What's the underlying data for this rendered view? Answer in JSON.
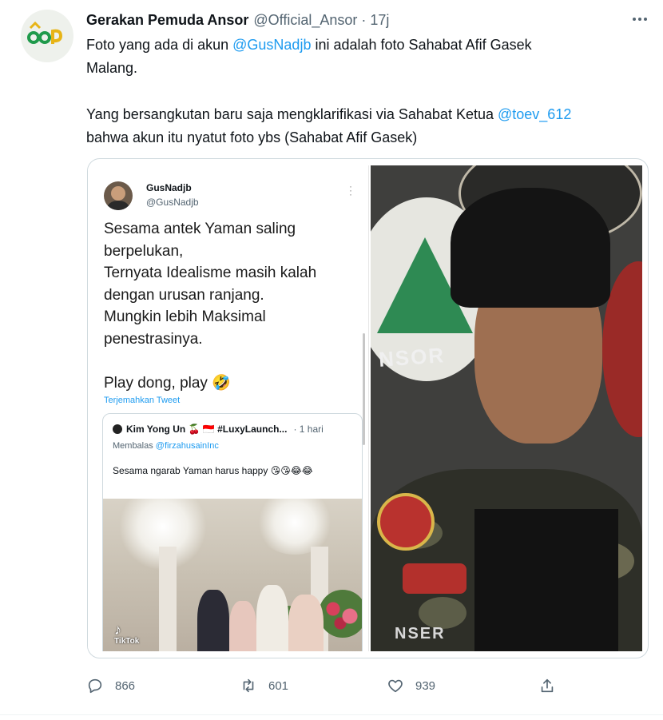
{
  "tweet": {
    "author_name": "Gerakan Pemuda Ansor",
    "author_handle": "@Official_Ansor",
    "separator": "·",
    "time": "17j",
    "text": {
      "line1_a": "Foto yang ada di akun ",
      "line1_link": "@GusNadjb",
      "line1_b": " ini adalah foto Sahabat Afif Gasek",
      "line2": "Malang.",
      "line3_a": "Yang bersangkutan baru saja mengklarifikasi via Sahabat Ketua ",
      "line3_link": "@toev_612",
      "line4": "bahwa akun itu nyatut foto ybs (Sahabat Afif Gasek)"
    },
    "actions": {
      "reply_count": "866",
      "retweet_count": "601",
      "like_count": "939"
    },
    "icons": {
      "more": "more-horizontal-icon",
      "reply": "reply-bubble-icon",
      "retweet": "retweet-icon",
      "like": "heart-icon",
      "share": "share-icon"
    }
  },
  "embedded_screenshot": {
    "name": "GusNadjb",
    "handle": "@GusNadjb",
    "lines": [
      "Sesama antek Yaman saling",
      "berpelukan,",
      "Ternyata Idealisme masih kalah",
      "dengan urusan ranjang.",
      "Mungkin lebih Maksimal",
      "penestrasinya."
    ],
    "play_line": "Play dong, play 🤣",
    "translate": "Terjemahkan Tweet",
    "quote": {
      "name": "Kim Yong Un 🍒 🇮🇩 #LuxyLaunch...",
      "time": "· 1 hari",
      "reply_prefix": "Membalas ",
      "reply_handle": "@firzahusainInc",
      "text": "Sesama ngarab Yaman harus happy",
      "emojis": "😘😘😂😂",
      "watermark": "TikTok"
    }
  },
  "photo_text": {
    "patch_label": "NSOR",
    "shirt_label": "NSER"
  },
  "colors": {
    "link": "#1d9bf0",
    "secondary": "#536471",
    "primary": "#0f1419",
    "border": "#cfd9de"
  }
}
